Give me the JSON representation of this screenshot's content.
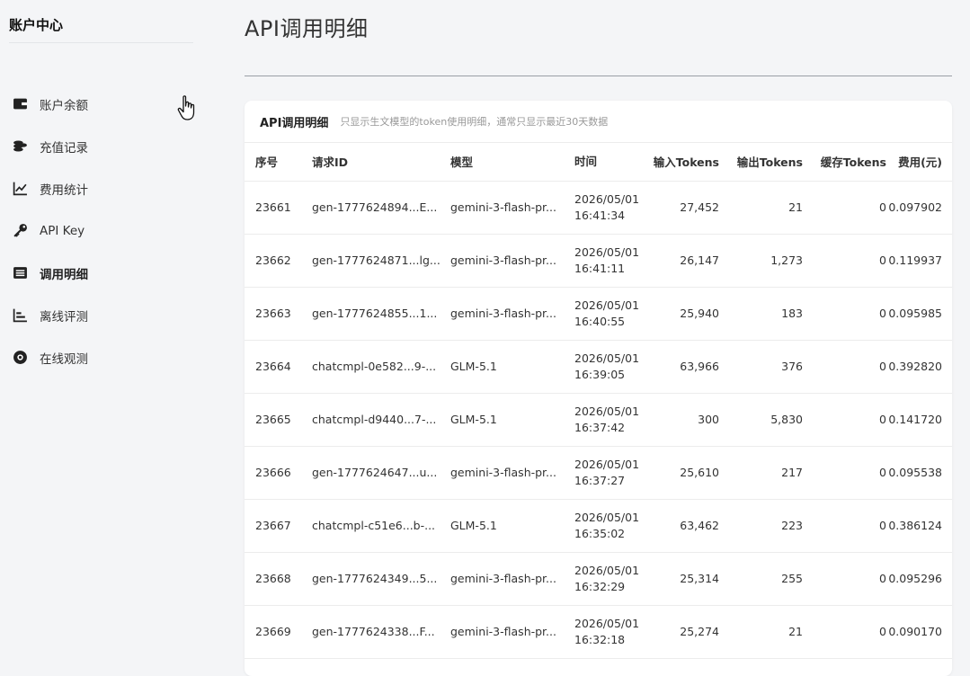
{
  "sidebar": {
    "title": "账户中心",
    "items": [
      {
        "label": "账户余额",
        "icon": "wallet-icon"
      },
      {
        "label": "充值记录",
        "icon": "coins-icon"
      },
      {
        "label": "费用统计",
        "icon": "trend-chart-icon"
      },
      {
        "label": "API Key",
        "icon": "key-icon"
      },
      {
        "label": "调用明细",
        "icon": "list-icon",
        "active": true
      },
      {
        "label": "离线评测",
        "icon": "bar-chart-icon"
      },
      {
        "label": "在线观测",
        "icon": "eye-icon"
      }
    ]
  },
  "page": {
    "title": "API调用明细"
  },
  "card": {
    "title": "API调用明细",
    "subtitle": "只显示生文模型的token使用明细，通常只显示最近30天数据"
  },
  "table": {
    "columns": [
      "序号",
      "请求ID",
      "模型",
      "时间",
      "输入Tokens",
      "输出Tokens",
      "缓存Tokens",
      "费用(元)"
    ],
    "rows": [
      {
        "seq": "23661",
        "request_id": "gen-1777624894...E...",
        "model": "gemini-3-flash-pr...",
        "date": "2026/05/01",
        "time": "16:41:34",
        "input": "27,452",
        "output": "21",
        "cache": "0",
        "fee": "0.097902"
      },
      {
        "seq": "23662",
        "request_id": "gen-1777624871...lg...",
        "model": "gemini-3-flash-pr...",
        "date": "2026/05/01",
        "time": "16:41:11",
        "input": "26,147",
        "output": "1,273",
        "cache": "0",
        "fee": "0.119937"
      },
      {
        "seq": "23663",
        "request_id": "gen-1777624855...1...",
        "model": "gemini-3-flash-pr...",
        "date": "2026/05/01",
        "time": "16:40:55",
        "input": "25,940",
        "output": "183",
        "cache": "0",
        "fee": "0.095985"
      },
      {
        "seq": "23664",
        "request_id": "chatcmpl-0e582...9-...",
        "model": "GLM-5.1",
        "date": "2026/05/01",
        "time": "16:39:05",
        "input": "63,966",
        "output": "376",
        "cache": "0",
        "fee": "0.392820"
      },
      {
        "seq": "23665",
        "request_id": "chatcmpl-d9440...7-...",
        "model": "GLM-5.1",
        "date": "2026/05/01",
        "time": "16:37:42",
        "input": "300",
        "output": "5,830",
        "cache": "0",
        "fee": "0.141720"
      },
      {
        "seq": "23666",
        "request_id": "gen-1777624647...u...",
        "model": "gemini-3-flash-pr...",
        "date": "2026/05/01",
        "time": "16:37:27",
        "input": "25,610",
        "output": "217",
        "cache": "0",
        "fee": "0.095538"
      },
      {
        "seq": "23667",
        "request_id": "chatcmpl-c51e6...b-...",
        "model": "GLM-5.1",
        "date": "2026/05/01",
        "time": "16:35:02",
        "input": "63,462",
        "output": "223",
        "cache": "0",
        "fee": "0.386124"
      },
      {
        "seq": "23668",
        "request_id": "gen-1777624349...5...",
        "model": "gemini-3-flash-pr...",
        "date": "2026/05/01",
        "time": "16:32:29",
        "input": "25,314",
        "output": "255",
        "cache": "0",
        "fee": "0.095296"
      },
      {
        "seq": "23669",
        "request_id": "gen-1777624338...F...",
        "model": "gemini-3-flash-pr...",
        "date": "2026/05/01",
        "time": "16:32:18",
        "input": "25,274",
        "output": "21",
        "cache": "0",
        "fee": "0.090170"
      }
    ]
  }
}
